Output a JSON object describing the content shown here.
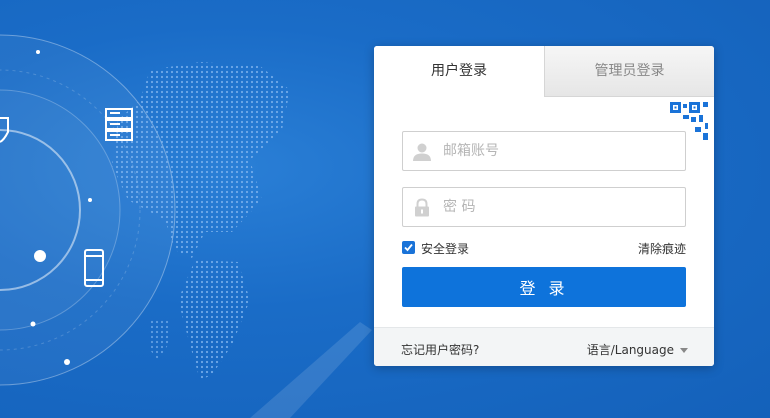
{
  "tabs": {
    "user": "用户登录",
    "admin": "管理员登录"
  },
  "form": {
    "account_placeholder": "邮箱账号",
    "password_placeholder": "密 码",
    "remember_label": "安全登录",
    "remember_checked": true,
    "clear_traces": "清除痕迹",
    "submit": "登 录"
  },
  "footer": {
    "forgot": "忘记用户密码?",
    "language": "语言/Language"
  },
  "icons": [
    "world-map-graphic",
    "server-icon",
    "phone-icon",
    "shield-icon",
    "qr-code-icon",
    "user-icon",
    "lock-icon",
    "checkmark-icon",
    "caret-down-icon"
  ],
  "colors": {
    "background": "#1565c0",
    "primary_button": "#0e73db",
    "checkbox": "#1a73d8",
    "footer_bg": "#f3f5f6"
  }
}
